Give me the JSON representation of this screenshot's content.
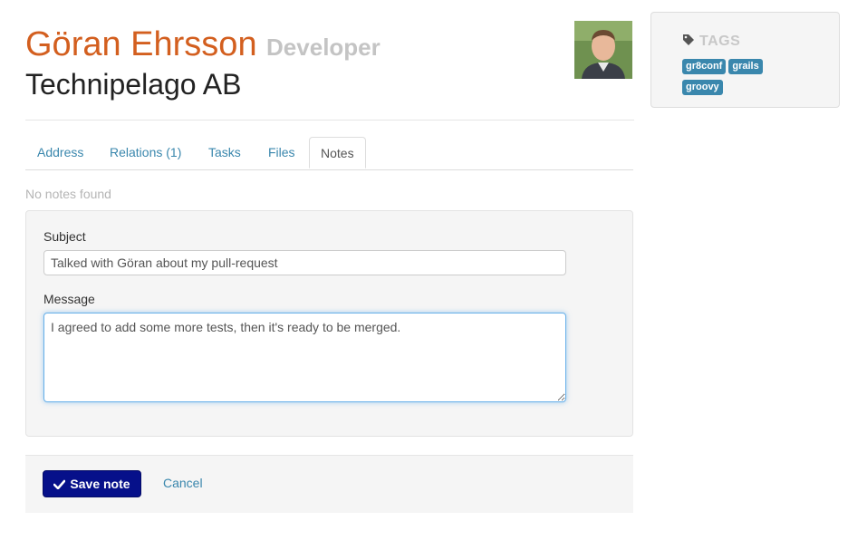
{
  "contact": {
    "name": "Göran Ehrsson",
    "role": "Developer",
    "company": "Technipelago AB"
  },
  "avatar": {
    "description_icon": "person-photo"
  },
  "tags": {
    "title": "TAGS",
    "icon": "tags-icon",
    "items": [
      "gr8conf",
      "grails",
      "groovy"
    ],
    "color": "#3a87ad"
  },
  "tabs": [
    {
      "label": "Address"
    },
    {
      "label": "Relations (1)"
    },
    {
      "label": "Tasks"
    },
    {
      "label": "Files"
    },
    {
      "label": "Notes"
    }
  ],
  "active_tab": "Notes",
  "notes": {
    "empty_message": "No notes found",
    "subject_label": "Subject",
    "subject_value": "Talked with Göran about my pull-request",
    "message_label": "Message",
    "message_value": "I agreed to add some more tests, then it's ready to be merged."
  },
  "actions": {
    "save_label": "Save note",
    "cancel_label": "Cancel"
  },
  "colors": {
    "name": "#d35f1f",
    "link": "#3a87ad",
    "primary_button": "#06108a"
  }
}
